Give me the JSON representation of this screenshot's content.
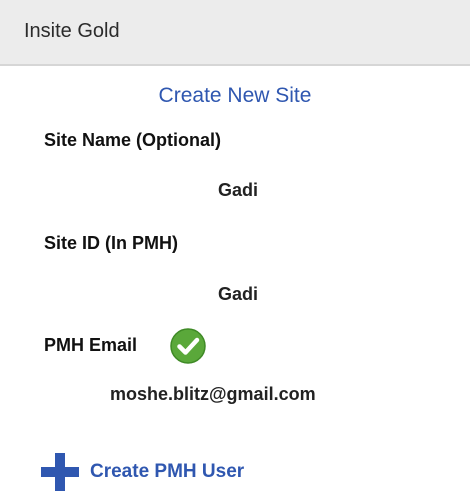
{
  "app_bar": {
    "title": "Insite Gold"
  },
  "form": {
    "heading": "Create New Site",
    "site_name": {
      "label": "Site Name (Optional)",
      "value": "Gadi"
    },
    "site_id": {
      "label": "Site ID (In PMH)",
      "value": "Gadi"
    },
    "pmh_email": {
      "label": "PMH Email",
      "value": "moshe.blitz@gmail.com",
      "status_icon": "check-circle-icon",
      "status_color": "#5aa83a"
    }
  },
  "actions": {
    "create_user_label": "Create PMH User",
    "create_user_icon": "plus-icon",
    "accent_color": "#2f57b0"
  }
}
